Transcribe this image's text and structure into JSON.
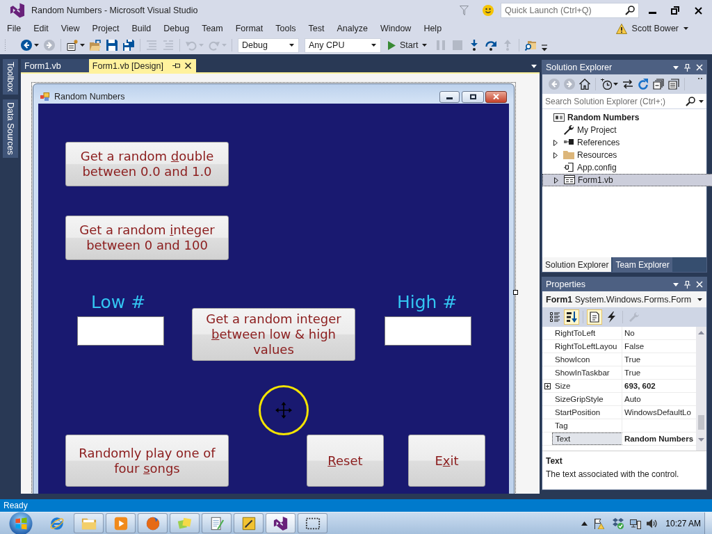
{
  "window": {
    "title": "Random Numbers - Microsoft Visual Studio",
    "quick_launch": {
      "placeholder": "Quick Launch (Ctrl+Q)"
    }
  },
  "menu_bar": {
    "items": [
      "File",
      "Edit",
      "View",
      "Project",
      "Build",
      "Debug",
      "Team",
      "Format",
      "Tools",
      "Test",
      "Analyze",
      "Window",
      "Help"
    ],
    "user": "Scott Bower"
  },
  "toolbar": {
    "items": [
      {
        "kind": "back",
        "disabled": false,
        "menu": true
      },
      {
        "kind": "forward",
        "disabled": true,
        "menu": false
      },
      {
        "kind": "separator"
      },
      {
        "kind": "new-project",
        "disabled": false,
        "menu": true
      },
      {
        "kind": "open",
        "disabled": false,
        "menu": false
      },
      {
        "kind": "save",
        "disabled": false,
        "menu": false
      },
      {
        "kind": "save-all",
        "disabled": false,
        "menu": false
      },
      {
        "kind": "separator"
      },
      {
        "kind": "comment",
        "disabled": true,
        "menu": false
      },
      {
        "kind": "uncomment",
        "disabled": true,
        "menu": false
      },
      {
        "kind": "separator"
      },
      {
        "kind": "undo",
        "disabled": true,
        "menu": true
      },
      {
        "kind": "redo",
        "disabled": true,
        "menu": true
      },
      {
        "kind": "separator"
      },
      {
        "kind": "combo",
        "value": "Debug"
      },
      {
        "kind": "combo",
        "value": "Any CPU"
      },
      {
        "kind": "start",
        "label": "Start",
        "disabled": false,
        "menu": true
      },
      {
        "kind": "pause",
        "disabled": true,
        "menu": false
      },
      {
        "kind": "stop",
        "disabled": true,
        "menu": false
      },
      {
        "kind": "step-into",
        "disabled": false,
        "menu": false
      },
      {
        "kind": "step-over",
        "disabled": false,
        "menu": false
      },
      {
        "kind": "step-out",
        "disabled": true,
        "menu": false
      },
      {
        "kind": "separator"
      },
      {
        "kind": "find",
        "disabled": false,
        "menu": false
      },
      {
        "kind": "overflow"
      }
    ]
  },
  "side_tabs": [
    "Toolbox",
    "Data Sources"
  ],
  "document_tabs": [
    {
      "label": "Form1.vb",
      "selected": false
    },
    {
      "label": "Form1.vb [Design]",
      "selected": true
    }
  ],
  "designer": {
    "form": {
      "title": "Random Numbers",
      "controls": [
        {
          "kind": "button",
          "text_before": "Get a random ",
          "access_key": "d",
          "text_after": "ouble between 0.0 and 1.0"
        },
        {
          "kind": "button",
          "text_before": "Get a random ",
          "access_key": "i",
          "text_after": "nteger between 0 and 100"
        },
        {
          "kind": "label",
          "text": "Low #"
        },
        {
          "kind": "textbox"
        },
        {
          "kind": "button",
          "text_before": "Get a random integer ",
          "access_key": "b",
          "text_after": "etween low & high values"
        },
        {
          "kind": "label",
          "text": "High #"
        },
        {
          "kind": "textbox"
        },
        {
          "kind": "button",
          "text_before": "Randomly play one of four ",
          "access_key": "s",
          "text_after": "ongs"
        },
        {
          "kind": "button",
          "access_key": "R",
          "text_after": "eset"
        },
        {
          "kind": "button",
          "text_before": "E",
          "access_key": "x",
          "text_after": "it"
        }
      ]
    }
  },
  "solution_explorer": {
    "title": "Solution Explorer",
    "toolbar": [
      {
        "kind": "back",
        "disabled": true,
        "menu": false
      },
      {
        "kind": "forward",
        "disabled": true,
        "menu": false
      },
      {
        "kind": "home",
        "disabled": false,
        "menu": false
      },
      {
        "kind": "separator"
      },
      {
        "kind": "pending",
        "disabled": false,
        "menu": true
      },
      {
        "kind": "sync",
        "disabled": false,
        "menu": false
      },
      {
        "kind": "refresh",
        "disabled": false,
        "menu": false
      },
      {
        "kind": "collapse",
        "disabled": false,
        "menu": false
      },
      {
        "kind": "show-all",
        "disabled": false,
        "menu": false
      },
      {
        "kind": "separator"
      },
      {
        "kind": "overflow"
      }
    ],
    "search": {
      "placeholder": "Search Solution Explorer (Ctrl+;)"
    },
    "tree": [
      {
        "label": "Random Numbers",
        "kind": "project",
        "selected": false,
        "children": [
          {
            "label": "My Project",
            "kind": "my-project",
            "selected": false
          },
          {
            "label": "References",
            "kind": "references",
            "expanded": false,
            "selected": false
          },
          {
            "label": "Resources",
            "kind": "folder",
            "expanded": false,
            "selected": false
          },
          {
            "label": "App.config",
            "kind": "config",
            "selected": false
          },
          {
            "label": "Form1.vb",
            "kind": "form",
            "expanded": false,
            "selected": true
          }
        ]
      }
    ],
    "tabs": [
      {
        "label": "Solution Explorer",
        "selected": true
      },
      {
        "label": "Team Explorer",
        "selected": false
      }
    ]
  },
  "properties": {
    "title": "Properties",
    "object": {
      "name": "Form1",
      "type": "System.Windows.Forms.Form"
    },
    "toolbar": [
      {
        "kind": "categorized",
        "selected": false,
        "disabled": false
      },
      {
        "kind": "alphabetical",
        "selected": true,
        "disabled": false
      },
      {
        "kind": "separator"
      },
      {
        "kind": "properties",
        "selected": true,
        "disabled": false
      },
      {
        "kind": "events",
        "selected": false,
        "disabled": false
      },
      {
        "kind": "separator"
      },
      {
        "kind": "property-pages",
        "selected": false,
        "disabled": true
      }
    ],
    "rows": [
      {
        "name": "RightToLeft",
        "value": "No",
        "modified": false,
        "selected": false
      },
      {
        "name": "RightToLeftLayou",
        "value": "False",
        "modified": false,
        "selected": false
      },
      {
        "name": "ShowIcon",
        "value": "True",
        "modified": false,
        "selected": false
      },
      {
        "name": "ShowInTaskbar",
        "value": "True",
        "modified": false,
        "selected": false
      },
      {
        "name": "Size",
        "value": "693, 602",
        "modified": true,
        "expanded": false,
        "selected": false
      },
      {
        "name": "SizeGripStyle",
        "value": "Auto",
        "modified": false,
        "selected": false
      },
      {
        "name": "StartPosition",
        "value": "WindowsDefaultLo",
        "modified": false,
        "selected": false
      },
      {
        "name": "Tag",
        "selected": false
      },
      {
        "name": "Text",
        "value": "Random Numbers",
        "modified": true,
        "selected": true
      }
    ],
    "description": {
      "title": "Text",
      "text": "The text associated with the control."
    }
  },
  "status_bar": {
    "text": "Ready"
  },
  "taskbar": {
    "apps": [
      {
        "kind": "ie",
        "running": false,
        "selected": false
      },
      {
        "kind": "explorer",
        "running": true,
        "selected": false
      },
      {
        "kind": "media",
        "running": true,
        "selected": false
      },
      {
        "kind": "firefox",
        "running": true,
        "selected": false
      },
      {
        "kind": "photos",
        "running": true,
        "selected": false
      },
      {
        "kind": "notepad",
        "running": true,
        "selected": false
      },
      {
        "kind": "sketch",
        "running": true,
        "selected": false
      },
      {
        "kind": "vs",
        "running": true,
        "selected": true
      },
      {
        "kind": "snip",
        "running": true,
        "selected": false
      }
    ],
    "clock": "10:27 AM"
  }
}
